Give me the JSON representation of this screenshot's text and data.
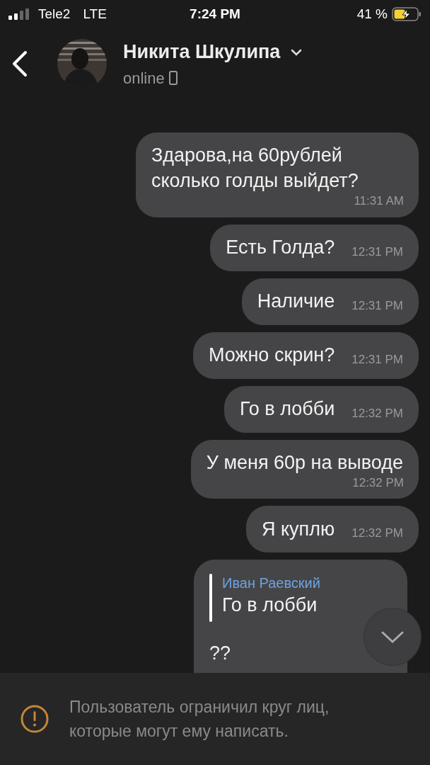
{
  "status_bar": {
    "carrier": "Tele2",
    "network": "LTE",
    "time": "7:24 PM",
    "battery": "41 %"
  },
  "header": {
    "name": "Никита Шкулипа",
    "status": "online"
  },
  "messages": [
    {
      "kind": "stacked",
      "text": "Здарова,на 60рублей сколько голды выйдет?",
      "time": "11:31 AM"
    },
    {
      "kind": "inline",
      "text": "Есть Голда?",
      "time": "12:31 PM"
    },
    {
      "kind": "inline",
      "text": "Наличие",
      "time": "12:31 PM"
    },
    {
      "kind": "inline",
      "text": "Можно скрин?",
      "time": "12:31 PM"
    },
    {
      "kind": "inline",
      "text": "Го в лобби",
      "time": "12:32 PM"
    },
    {
      "kind": "stacked",
      "text": "У меня 60р на выводе",
      "time": "12:32 PM"
    },
    {
      "kind": "inline",
      "text": "Я куплю",
      "time": "12:32 PM"
    },
    {
      "kind": "reply",
      "reply_author": "Иван Раевский",
      "reply_text": "Го в лобби",
      "text": "??"
    }
  ],
  "notice": "Пользователь ограничил круг лиц, которые могут ему написать."
}
